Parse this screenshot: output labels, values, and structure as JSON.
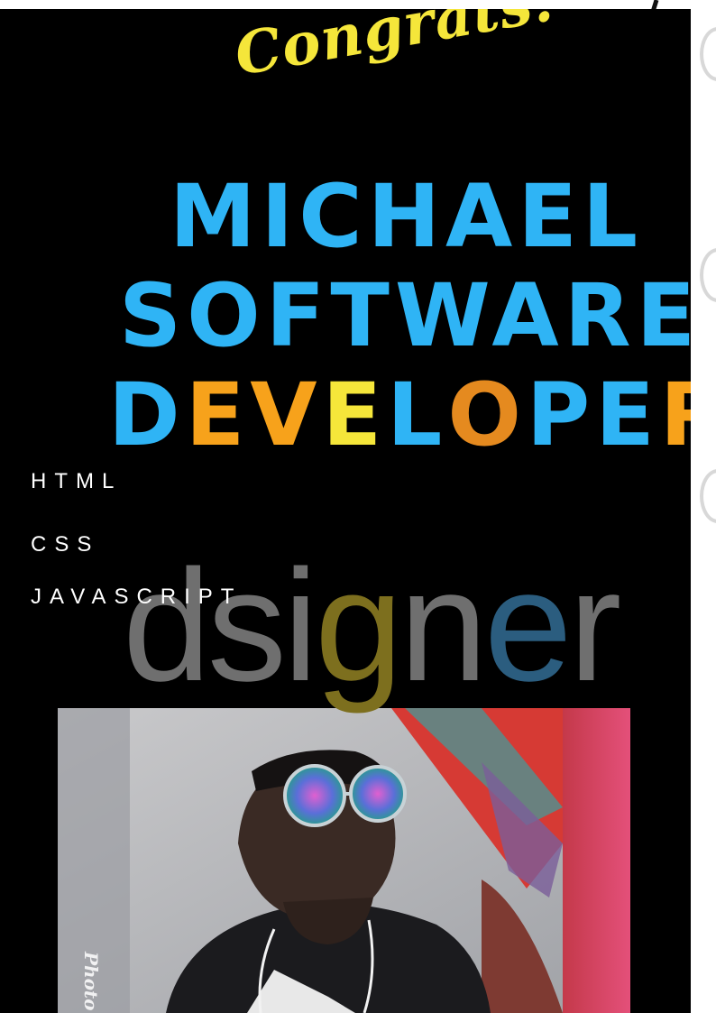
{
  "congrats": "Congrats!",
  "headline": {
    "line1": [
      {
        "t": "MICHAEL",
        "c": "#2fb4f5"
      }
    ],
    "line2": [
      {
        "t": "SOFTWARE",
        "c": "#2fb4f5"
      }
    ],
    "line3": [
      {
        "t": "D",
        "c": "#2fb4f5"
      },
      {
        "t": "E",
        "c": "#f7a21b"
      },
      {
        "t": "V",
        "c": "#f7a21b"
      },
      {
        "t": "E",
        "c": "#f5e63a"
      },
      {
        "t": "L",
        "c": "#2fb4f5"
      },
      {
        "t": "O",
        "c": "#e58a1f"
      },
      {
        "t": "P",
        "c": "#2fb4f5"
      },
      {
        "t": "E",
        "c": "#2fb4f5"
      },
      {
        "t": "R",
        "c": "#f7a21b"
      }
    ]
  },
  "skills": [
    "HTML",
    "CSS",
    "JAVASCRIPT"
  ],
  "dsigner": [
    {
      "t": "ds",
      "c": "#6f6f6f"
    },
    {
      "t": "i",
      "c": "#6f6f6f"
    },
    {
      "t": "g",
      "c": "#7d6f1e"
    },
    {
      "t": "n",
      "c": "#6f6f6f"
    },
    {
      "t": "e",
      "c": "#2b5d7f"
    },
    {
      "t": "r",
      "c": "#6f6f6f"
    }
  ],
  "photo": {
    "alt": "selfie photo",
    "watermark": "Photo"
  },
  "colors": {
    "background": "#000000",
    "accent_blue": "#2fb4f5",
    "accent_yellow": "#f5e63a",
    "accent_orange": "#f7a21b"
  }
}
